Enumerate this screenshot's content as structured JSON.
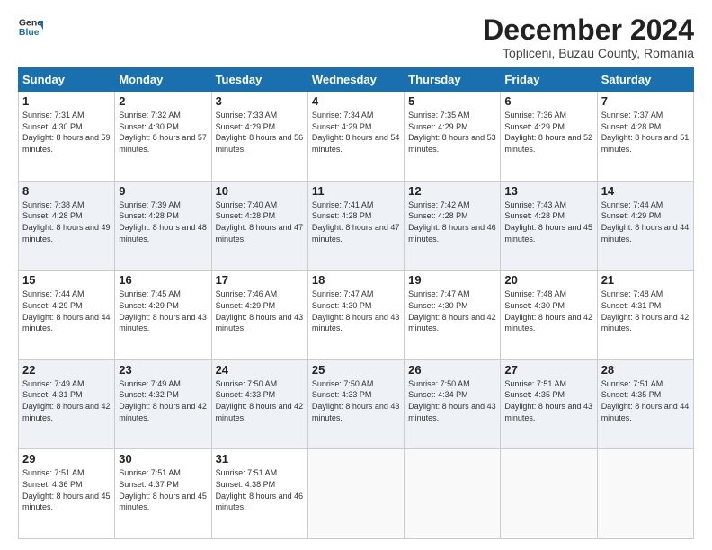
{
  "header": {
    "logo_line1": "General",
    "logo_line2": "Blue",
    "month_title": "December 2024",
    "subtitle": "Topliceni, Buzau County, Romania"
  },
  "weekdays": [
    "Sunday",
    "Monday",
    "Tuesday",
    "Wednesday",
    "Thursday",
    "Friday",
    "Saturday"
  ],
  "weeks": [
    [
      {
        "day": "1",
        "sunrise": "Sunrise: 7:31 AM",
        "sunset": "Sunset: 4:30 PM",
        "daylight": "Daylight: 8 hours and 59 minutes."
      },
      {
        "day": "2",
        "sunrise": "Sunrise: 7:32 AM",
        "sunset": "Sunset: 4:30 PM",
        "daylight": "Daylight: 8 hours and 57 minutes."
      },
      {
        "day": "3",
        "sunrise": "Sunrise: 7:33 AM",
        "sunset": "Sunset: 4:29 PM",
        "daylight": "Daylight: 8 hours and 56 minutes."
      },
      {
        "day": "4",
        "sunrise": "Sunrise: 7:34 AM",
        "sunset": "Sunset: 4:29 PM",
        "daylight": "Daylight: 8 hours and 54 minutes."
      },
      {
        "day": "5",
        "sunrise": "Sunrise: 7:35 AM",
        "sunset": "Sunset: 4:29 PM",
        "daylight": "Daylight: 8 hours and 53 minutes."
      },
      {
        "day": "6",
        "sunrise": "Sunrise: 7:36 AM",
        "sunset": "Sunset: 4:29 PM",
        "daylight": "Daylight: 8 hours and 52 minutes."
      },
      {
        "day": "7",
        "sunrise": "Sunrise: 7:37 AM",
        "sunset": "Sunset: 4:28 PM",
        "daylight": "Daylight: 8 hours and 51 minutes."
      }
    ],
    [
      {
        "day": "8",
        "sunrise": "Sunrise: 7:38 AM",
        "sunset": "Sunset: 4:28 PM",
        "daylight": "Daylight: 8 hours and 49 minutes."
      },
      {
        "day": "9",
        "sunrise": "Sunrise: 7:39 AM",
        "sunset": "Sunset: 4:28 PM",
        "daylight": "Daylight: 8 hours and 48 minutes."
      },
      {
        "day": "10",
        "sunrise": "Sunrise: 7:40 AM",
        "sunset": "Sunset: 4:28 PM",
        "daylight": "Daylight: 8 hours and 47 minutes."
      },
      {
        "day": "11",
        "sunrise": "Sunrise: 7:41 AM",
        "sunset": "Sunset: 4:28 PM",
        "daylight": "Daylight: 8 hours and 47 minutes."
      },
      {
        "day": "12",
        "sunrise": "Sunrise: 7:42 AM",
        "sunset": "Sunset: 4:28 PM",
        "daylight": "Daylight: 8 hours and 46 minutes."
      },
      {
        "day": "13",
        "sunrise": "Sunrise: 7:43 AM",
        "sunset": "Sunset: 4:28 PM",
        "daylight": "Daylight: 8 hours and 45 minutes."
      },
      {
        "day": "14",
        "sunrise": "Sunrise: 7:44 AM",
        "sunset": "Sunset: 4:29 PM",
        "daylight": "Daylight: 8 hours and 44 minutes."
      }
    ],
    [
      {
        "day": "15",
        "sunrise": "Sunrise: 7:44 AM",
        "sunset": "Sunset: 4:29 PM",
        "daylight": "Daylight: 8 hours and 44 minutes."
      },
      {
        "day": "16",
        "sunrise": "Sunrise: 7:45 AM",
        "sunset": "Sunset: 4:29 PM",
        "daylight": "Daylight: 8 hours and 43 minutes."
      },
      {
        "day": "17",
        "sunrise": "Sunrise: 7:46 AM",
        "sunset": "Sunset: 4:29 PM",
        "daylight": "Daylight: 8 hours and 43 minutes."
      },
      {
        "day": "18",
        "sunrise": "Sunrise: 7:47 AM",
        "sunset": "Sunset: 4:30 PM",
        "daylight": "Daylight: 8 hours and 43 minutes."
      },
      {
        "day": "19",
        "sunrise": "Sunrise: 7:47 AM",
        "sunset": "Sunset: 4:30 PM",
        "daylight": "Daylight: 8 hours and 42 minutes."
      },
      {
        "day": "20",
        "sunrise": "Sunrise: 7:48 AM",
        "sunset": "Sunset: 4:30 PM",
        "daylight": "Daylight: 8 hours and 42 minutes."
      },
      {
        "day": "21",
        "sunrise": "Sunrise: 7:48 AM",
        "sunset": "Sunset: 4:31 PM",
        "daylight": "Daylight: 8 hours and 42 minutes."
      }
    ],
    [
      {
        "day": "22",
        "sunrise": "Sunrise: 7:49 AM",
        "sunset": "Sunset: 4:31 PM",
        "daylight": "Daylight: 8 hours and 42 minutes."
      },
      {
        "day": "23",
        "sunrise": "Sunrise: 7:49 AM",
        "sunset": "Sunset: 4:32 PM",
        "daylight": "Daylight: 8 hours and 42 minutes."
      },
      {
        "day": "24",
        "sunrise": "Sunrise: 7:50 AM",
        "sunset": "Sunset: 4:33 PM",
        "daylight": "Daylight: 8 hours and 42 minutes."
      },
      {
        "day": "25",
        "sunrise": "Sunrise: 7:50 AM",
        "sunset": "Sunset: 4:33 PM",
        "daylight": "Daylight: 8 hours and 43 minutes."
      },
      {
        "day": "26",
        "sunrise": "Sunrise: 7:50 AM",
        "sunset": "Sunset: 4:34 PM",
        "daylight": "Daylight: 8 hours and 43 minutes."
      },
      {
        "day": "27",
        "sunrise": "Sunrise: 7:51 AM",
        "sunset": "Sunset: 4:35 PM",
        "daylight": "Daylight: 8 hours and 43 minutes."
      },
      {
        "day": "28",
        "sunrise": "Sunrise: 7:51 AM",
        "sunset": "Sunset: 4:35 PM",
        "daylight": "Daylight: 8 hours and 44 minutes."
      }
    ],
    [
      {
        "day": "29",
        "sunrise": "Sunrise: 7:51 AM",
        "sunset": "Sunset: 4:36 PM",
        "daylight": "Daylight: 8 hours and 45 minutes."
      },
      {
        "day": "30",
        "sunrise": "Sunrise: 7:51 AM",
        "sunset": "Sunset: 4:37 PM",
        "daylight": "Daylight: 8 hours and 45 minutes."
      },
      {
        "day": "31",
        "sunrise": "Sunrise: 7:51 AM",
        "sunset": "Sunset: 4:38 PM",
        "daylight": "Daylight: 8 hours and 46 minutes."
      },
      null,
      null,
      null,
      null
    ]
  ]
}
